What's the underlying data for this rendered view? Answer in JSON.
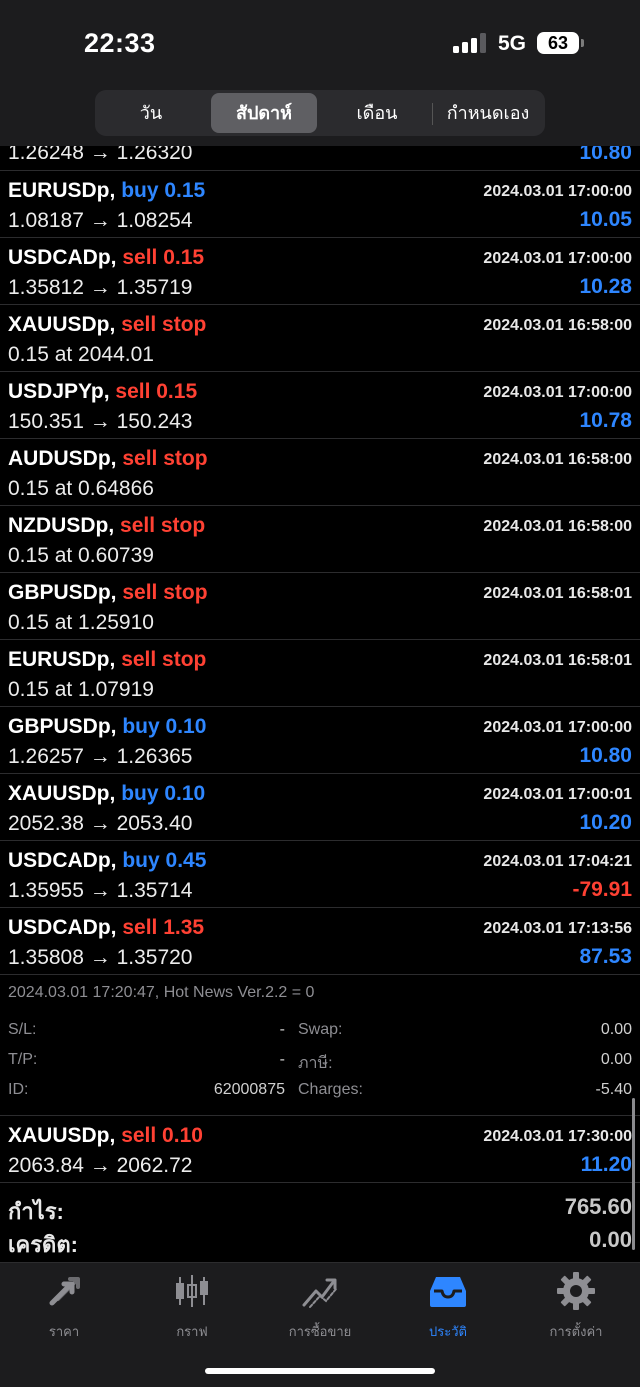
{
  "status_bar": {
    "time": "22:33",
    "network": "5G",
    "battery": "63"
  },
  "period_tabs": [
    {
      "label": "วัน",
      "active": false
    },
    {
      "label": "สัปดาห์",
      "active": true
    },
    {
      "label": "เดือน",
      "active": false
    },
    {
      "label": "กำหนดเอง",
      "active": false
    }
  ],
  "partial_row": {
    "detail": "1.26248 → 1.26320",
    "profit": "10.80"
  },
  "deals": [
    {
      "symbol": "EURUSDp,",
      "action": "buy 0.15",
      "side": "buy",
      "time": "2024.03.01 17:00:00",
      "detail": "1.08187 → 1.08254",
      "profit": "10.05"
    },
    {
      "symbol": "USDCADp,",
      "action": "sell 0.15",
      "side": "sell",
      "time": "2024.03.01 17:00:00",
      "detail": "1.35812 → 1.35719",
      "profit": "10.28"
    },
    {
      "symbol": "XAUUSDp,",
      "action": "sell stop",
      "side": "sell",
      "time": "2024.03.01 16:58:00",
      "detail": "0.15 at 2044.01",
      "profit": ""
    },
    {
      "symbol": "USDJPYp,",
      "action": "sell 0.15",
      "side": "sell",
      "time": "2024.03.01 17:00:00",
      "detail": "150.351 → 150.243",
      "profit": "10.78"
    },
    {
      "symbol": "AUDUSDp,",
      "action": "sell stop",
      "side": "sell",
      "time": "2024.03.01 16:58:00",
      "detail": "0.15 at 0.64866",
      "profit": ""
    },
    {
      "symbol": "NZDUSDp,",
      "action": "sell stop",
      "side": "sell",
      "time": "2024.03.01 16:58:00",
      "detail": "0.15 at 0.60739",
      "profit": ""
    },
    {
      "symbol": "GBPUSDp,",
      "action": "sell stop",
      "side": "sell",
      "time": "2024.03.01 16:58:01",
      "detail": "0.15 at 1.25910",
      "profit": ""
    },
    {
      "symbol": "EURUSDp,",
      "action": "sell stop",
      "side": "sell",
      "time": "2024.03.01 16:58:01",
      "detail": "0.15 at 1.07919",
      "profit": ""
    },
    {
      "symbol": "GBPUSDp,",
      "action": "buy 0.10",
      "side": "buy",
      "time": "2024.03.01 17:00:00",
      "detail": "1.26257 → 1.26365",
      "profit": "10.80"
    },
    {
      "symbol": "XAUUSDp,",
      "action": "buy 0.10",
      "side": "buy",
      "time": "2024.03.01 17:00:01",
      "detail": "2052.38 → 2053.40",
      "profit": "10.20"
    },
    {
      "symbol": "USDCADp,",
      "action": "buy 0.45",
      "side": "buy",
      "time": "2024.03.01 17:04:21",
      "detail": "1.35955 → 1.35714",
      "profit": "-79.91"
    },
    {
      "symbol": "USDCADp,",
      "action": "sell 1.35",
      "side": "sell",
      "time": "2024.03.01 17:13:56",
      "detail": "1.35808 → 1.35720",
      "profit": "87.53"
    }
  ],
  "expanded": {
    "comment": "2024.03.01 17:20:47, Hot News Ver.2.2 = 0",
    "sl_label": "S/L:",
    "sl_value": "-",
    "tp_label": "T/P:",
    "tp_value": "-",
    "id_label": "ID:",
    "id_value": "62000875",
    "swap_label": "Swap:",
    "swap_value": "0.00",
    "tax_label": "ภาษี:",
    "tax_value": "0.00",
    "charges_label": "Charges:",
    "charges_value": "-5.40"
  },
  "last_deal": {
    "symbol": "XAUUSDp,",
    "action": "sell 0.10",
    "side": "sell",
    "time": "2024.03.01 17:30:00",
    "detail": "2063.84 → 2062.72",
    "profit": "11.20"
  },
  "summary": [
    {
      "label": "กำไร:",
      "value": "765.60"
    },
    {
      "label": "เครดิต:",
      "value": "0.00"
    }
  ],
  "tabs": [
    {
      "label": "ราคา",
      "icon": "quotes-arrows-icon",
      "active": false
    },
    {
      "label": "กราฟ",
      "icon": "candlestick-chart-icon",
      "active": false
    },
    {
      "label": "การซื้อขาย",
      "icon": "trade-chart-icon",
      "active": false
    },
    {
      "label": "ประวัติ",
      "icon": "history-inbox-icon",
      "active": true
    },
    {
      "label": "การตั้งค่า",
      "icon": "gear-icon",
      "active": false
    }
  ],
  "colors": {
    "buy": "#2e86ff",
    "sell": "#ff4133",
    "profit_positive": "#2e86ff",
    "profit_negative": "#ff4133",
    "active_tab": "#2e86ff"
  }
}
